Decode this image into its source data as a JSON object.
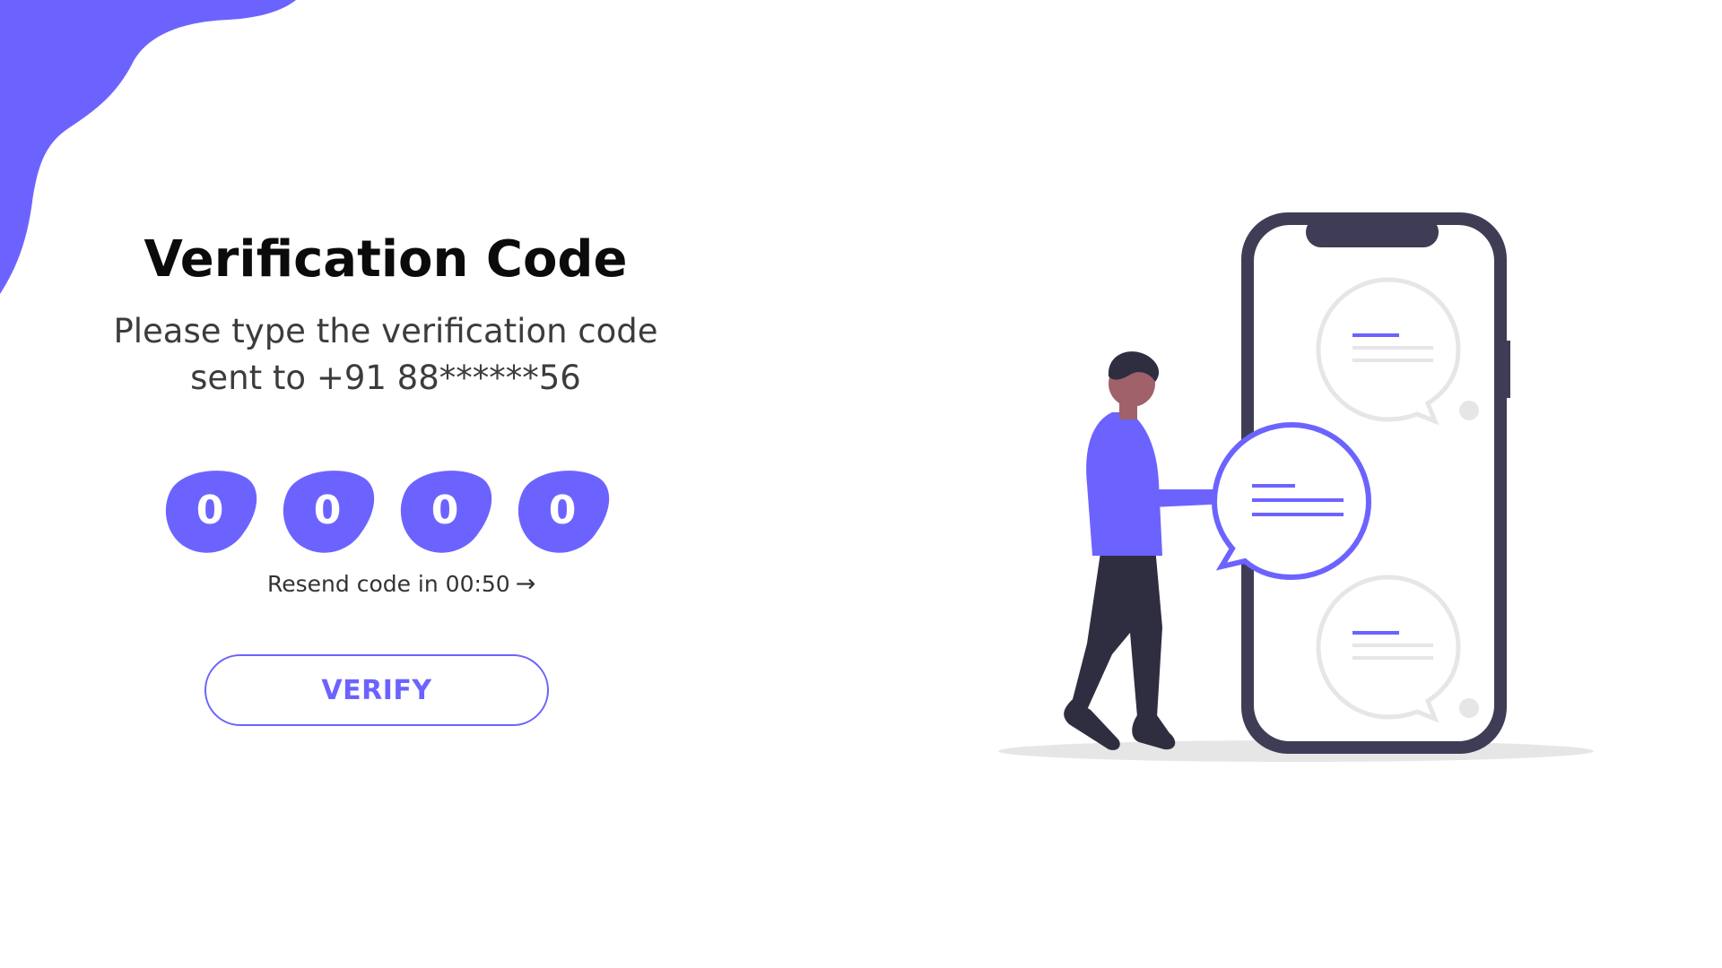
{
  "page": {
    "title": "Verification Code",
    "subtitle": "Please type the verification code sent to +91 88******56"
  },
  "code_inputs": [
    {
      "value": "0"
    },
    {
      "value": "0"
    },
    {
      "value": "0"
    },
    {
      "value": "0"
    }
  ],
  "resend": {
    "label": "Resend code in 00:50",
    "icon": "arrow-right-icon"
  },
  "verify_button": {
    "label": "VERIFY"
  },
  "colors": {
    "accent": "#6c63ff",
    "dark": "#3f3d56",
    "skin": "#a0616a",
    "bubble_gray": "#e6e6e6"
  }
}
